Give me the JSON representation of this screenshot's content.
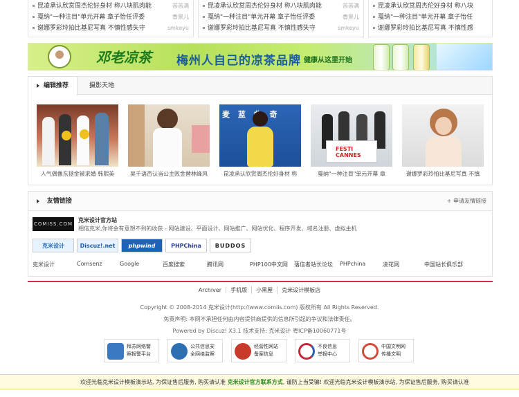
{
  "top_lists": [
    {
      "items": [
        {
          "text": "昆凌承认欣赏周杰伦好身材 称八块肌肉能",
          "author": "苦苦满"
        },
        {
          "text": "戛纳\"一种注目\"单元开幕 章子怡任评委",
          "author": "香景儿"
        },
        {
          "text": "谢娜罗彩玲拍比基尼写真 不慎性感失守",
          "author": "smkeyu"
        }
      ]
    },
    {
      "items": [
        {
          "text": "昆凌承认欣赏周杰伦好身材 称八块肌肉能",
          "author": "苦苦满"
        },
        {
          "text": "戛纳\"一种注目\"单元开幕 章子怡任评委",
          "author": "香景儿"
        },
        {
          "text": "谢娜罗彩玲拍比基尼写真 不慎性感失守",
          "author": "smkeyu"
        }
      ]
    },
    {
      "items": [
        {
          "text": "昆凌承认欣赏周杰伦好身材 称八块",
          "author": ""
        },
        {
          "text": "戛纳\"一种注目\"单元开幕 章子怡任",
          "author": ""
        },
        {
          "text": "谢娜罗彩玲拍比基尼写真 不慎性感",
          "author": ""
        }
      ]
    }
  ],
  "banner": {
    "brand": "邓老凉茶",
    "slogan": "梅州人自己的凉茶品牌",
    "sub": "健康从这里开始"
  },
  "featured": {
    "tabs": [
      "编辑推荐",
      "摄影天地"
    ],
    "photos": [
      {
        "caption": "人气偶像东拯金被求婚 韩熙英"
      },
      {
        "caption": "吴千语否认当公主败金替林峰风"
      },
      {
        "caption": "昆凌承认欣赏周杰伦好身材 称"
      },
      {
        "caption": "戛纳\"一种注目\"单元开幕 章"
      },
      {
        "caption": "谢娜罗彩玲拍比基尼写真 不慎"
      }
    ]
  },
  "friend_links": {
    "title": "友情链接",
    "apply": "+ 申请友情链接",
    "featured": {
      "logo_text": "COMISS.COM",
      "name": "克米设计官方站",
      "desc": "相信克米,你将会有意想不到的收获 - 网站建设、平面设计、网站推广、网站优化、程序开发、域名注册、虚拟主机"
    },
    "logos": [
      {
        "text": "克米设计",
        "bg": "#e7f2ff",
        "fg": "#2a6fb5"
      },
      {
        "text": "Discuz!.net",
        "bg": "#e9f3ff",
        "fg": "#1e5aa8"
      },
      {
        "text": "phpwind",
        "bg": "#1a63b8",
        "fg": "#ffffff"
      },
      {
        "text": "PHPChina",
        "bg": "#ffffff",
        "fg": "#2b3f88"
      },
      {
        "text": "BUDDOS",
        "bg": "#ffffff",
        "fg": "#222222"
      }
    ],
    "text_links": [
      "克米设计",
      "Comsenz",
      "Google",
      "百度搜索",
      "腾讯网",
      "PHP100中文网",
      "落信者站长论坛",
      "PHPchina",
      "凌花网",
      "中国站长俱乐部"
    ]
  },
  "footer": {
    "nav": [
      "Archiver",
      "手机版",
      "小黑屋",
      "克米设计模板店"
    ],
    "copyright": "Copyright © 2008-2014 克米设计(http://www.comiis.com) 版权所有 All Rights Reserved.",
    "disclaimer": "免责声明: 本网不承担任何由内容提供商提供的信息所引起的争议和法律责任。",
    "powered": "Powered by Discuz! X3.1  技术支持: 克米设计  粤ICP备10060771号",
    "badges": [
      {
        "text": "拜苏网络警\n察报警平台",
        "color": "#3a78c2"
      },
      {
        "text": "公共信息安\n全网络监察",
        "color": "#2d6fb0"
      },
      {
        "text": "经营性网站\n备案信息",
        "color": "#c83a2a"
      },
      {
        "text": "不良信息\n举报中心",
        "color": "#c2283a"
      },
      {
        "text": "中国文明网\n传播文明",
        "color": "#d14a3a"
      }
    ]
  },
  "notice": {
    "pre": "欢迎光临克米设计模板演示站, 为保证售后服务, 购买请认准 ",
    "highlight": "克米设计官方联系方式",
    "post": ", 谨防上当受骗! 欢迎光临克米设计模板演示站, 为保证售后服务, 购买请认准"
  }
}
